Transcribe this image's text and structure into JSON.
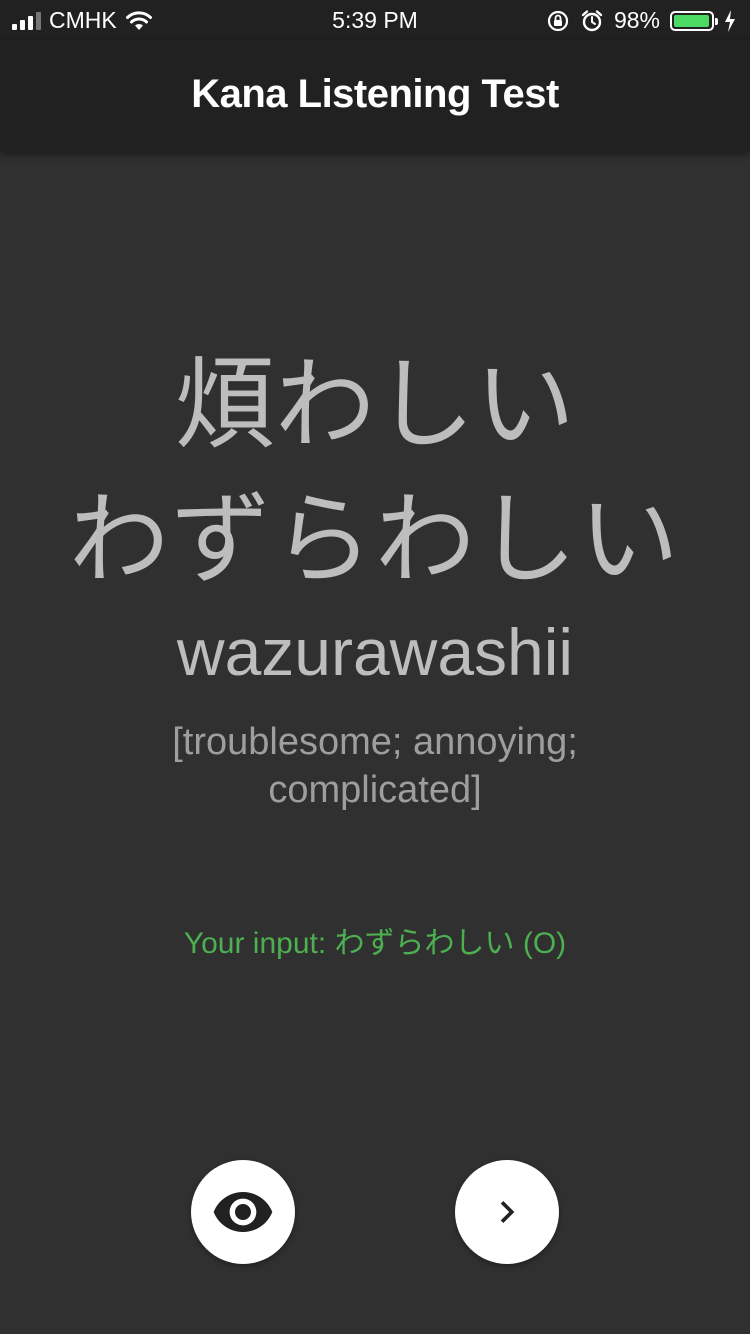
{
  "status_bar": {
    "carrier": "CMHK",
    "time": "5:39 PM",
    "battery_percent": "98%",
    "battery_level": 0.98,
    "signal_bars": 3,
    "icons": [
      "signal-icon",
      "wifi-icon",
      "orientation-lock-icon",
      "alarm-icon",
      "battery-icon",
      "charging-icon"
    ]
  },
  "app_bar": {
    "title": "Kana Listening Test"
  },
  "card": {
    "kanji": "煩わしい",
    "kana": "わずらわしい",
    "romaji": "wazurawashii",
    "meaning": "[troublesome; annoying; complicated]",
    "user_input": "Your input: わずらわしい (O)"
  },
  "actions": {
    "reveal_icon": "eye-icon",
    "next_icon": "chevron-right-icon"
  },
  "colors": {
    "background": "#303030",
    "app_bar": "#212121",
    "word_text": "#bdbdbd",
    "meaning_text": "#9e9e9e",
    "correct_input": "#4caf50",
    "button_bg": "#ffffff",
    "battery_fill": "#4cd964"
  }
}
